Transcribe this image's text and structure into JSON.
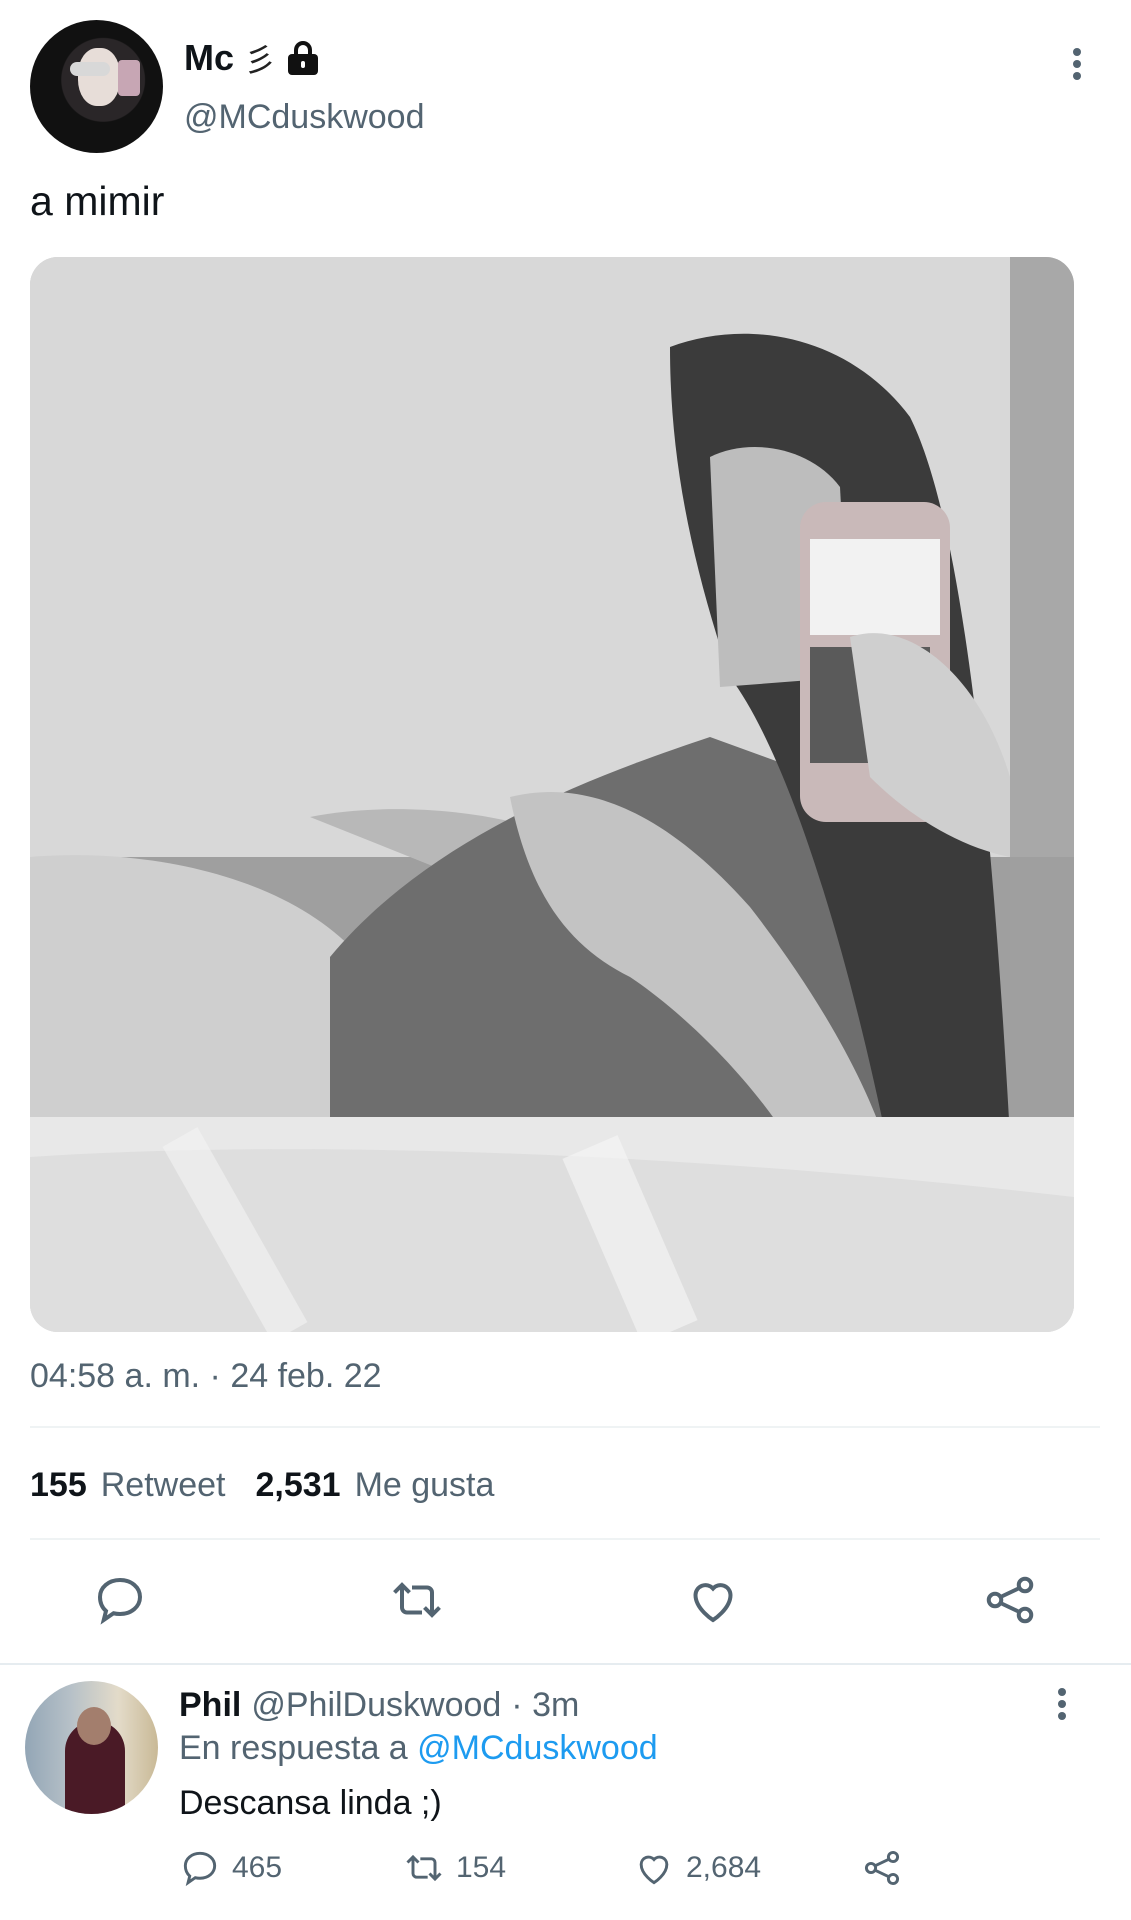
{
  "tweet": {
    "display_name": "Mc",
    "name_emoji": "彡",
    "handle": "@MCduskwood",
    "text": "a mimir",
    "timestamp": "04:58 a. m. · 24 feb. 22",
    "stats": {
      "retweets_count": "155",
      "retweets_label": "Retweet",
      "likes_count": "2,531",
      "likes_label": "Me gusta"
    },
    "media_alt": ""
  },
  "reply": {
    "display_name": "Phil",
    "handle": "@PhilDuskwood",
    "time": "· 3m",
    "reply_to_prefix": "En respuesta a",
    "reply_to_handle": "@MCduskwood",
    "text": "Descansa linda ;)",
    "counts": {
      "replies": "465",
      "retweets": "154",
      "likes": "2,684"
    }
  },
  "colors": {
    "text_primary": "#0f1419",
    "text_secondary": "#536471",
    "link": "#1d9bf0",
    "divider": "#eff3f4"
  },
  "icons": [
    "lock-icon",
    "more-icon",
    "reply-icon",
    "retweet-icon",
    "like-icon",
    "share-icon"
  ]
}
